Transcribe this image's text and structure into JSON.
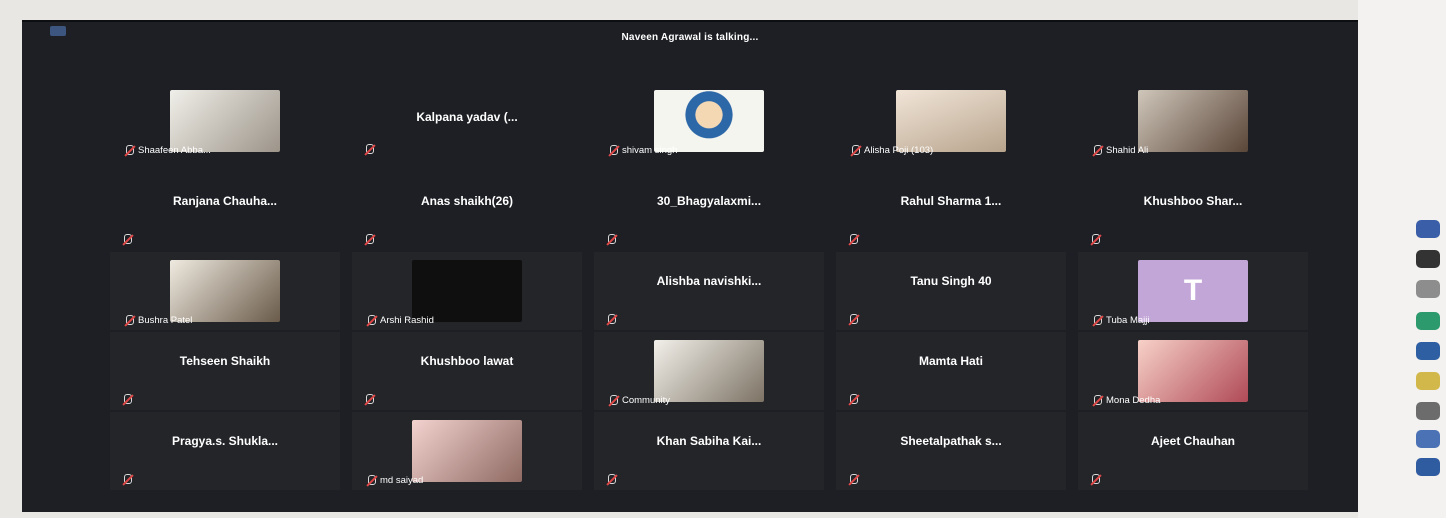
{
  "meeting": {
    "talking_indicator": "Naveen Agrawal is talking..."
  },
  "participants": [
    {
      "name": "Shaafeen Abba...",
      "video": true
    },
    {
      "name": "Kalpana yadav (...",
      "video": false
    },
    {
      "name": "shivam singh",
      "video": true
    },
    {
      "name": "Alisha Poji (103)",
      "video": true
    },
    {
      "name": "Shahid Ali",
      "video": true
    },
    {
      "name": "Ranjana Chauha...",
      "video": false
    },
    {
      "name": "Anas shaikh(26)",
      "video": false
    },
    {
      "name": "30_Bhagyalaxmi...",
      "video": false
    },
    {
      "name": "Rahul Sharma 1...",
      "video": false
    },
    {
      "name": "Khushboo Shar...",
      "video": false
    },
    {
      "name": "Bushra Patel",
      "video": true
    },
    {
      "name": "Arshi Rashid",
      "video": true
    },
    {
      "name": "Alishba navishki...",
      "video": false
    },
    {
      "name": "Tanu Singh 40",
      "video": false
    },
    {
      "name": "Tuba Majji",
      "video": true,
      "initial": "T"
    },
    {
      "name": "Tehseen Shaikh",
      "video": false
    },
    {
      "name": "Khushboo lawat",
      "video": false
    },
    {
      "name": "Community",
      "video": true
    },
    {
      "name": "Mamta Hati",
      "video": false
    },
    {
      "name": "Mona Dedha",
      "video": true
    },
    {
      "name": "Pragya.s. Shukla...",
      "video": false
    },
    {
      "name": "md saiyad",
      "video": true
    },
    {
      "name": "Khan Sabiha Kai...",
      "video": false
    },
    {
      "name": "Sheetalpathak s...",
      "video": false
    },
    {
      "name": "Ajeet Chauhan",
      "video": false
    }
  ],
  "colors": {
    "background": "#1d1f24",
    "tile": "#232529",
    "muted_mic": "#e04848",
    "text": "#ffffff",
    "initial_avatar": "#c3a6d8"
  }
}
